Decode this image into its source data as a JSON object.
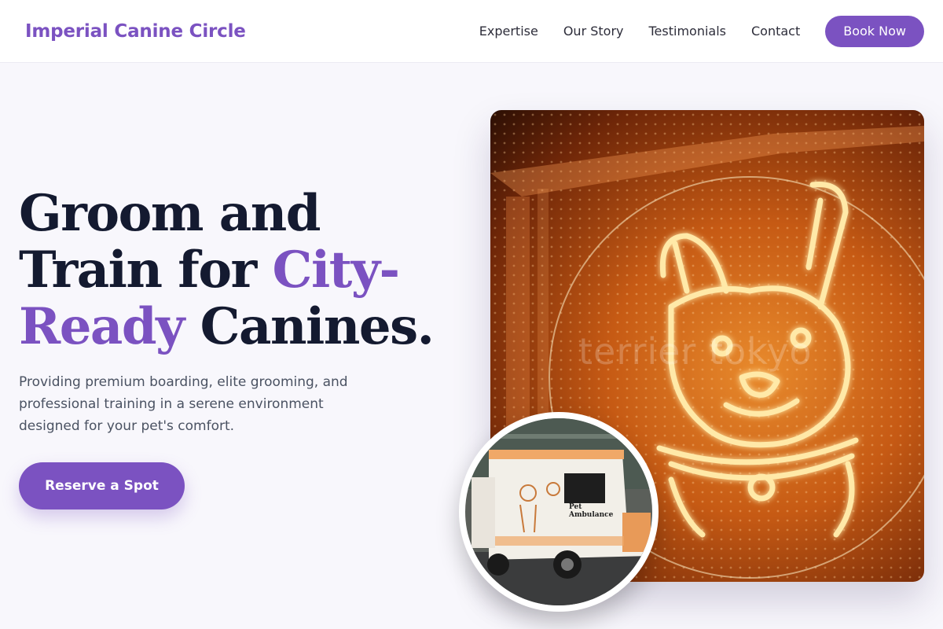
{
  "nav": {
    "brand": "Imperial Canine Circle",
    "links": [
      "Expertise",
      "Our Story",
      "Testimonials",
      "Contact"
    ],
    "cta": "Book Now"
  },
  "hero": {
    "title_line1": "Groom and",
    "title_line2a": "Train for ",
    "title_accent": "City-",
    "title_accent2": "Ready",
    "title_end": " Canines.",
    "subtitle": "Providing premium boarding, elite grooming, and professional training in a serene environment designed for your pet's comfort.",
    "cta": "Reserve a Spot"
  },
  "images": {
    "main_watermark": "terrier tokyo",
    "van_sign_line1": "Pet",
    "van_sign_line2": "Ambulance"
  },
  "colors": {
    "accent": "#7b52c1",
    "heading": "#141a30",
    "background": "#f8f7fc"
  }
}
